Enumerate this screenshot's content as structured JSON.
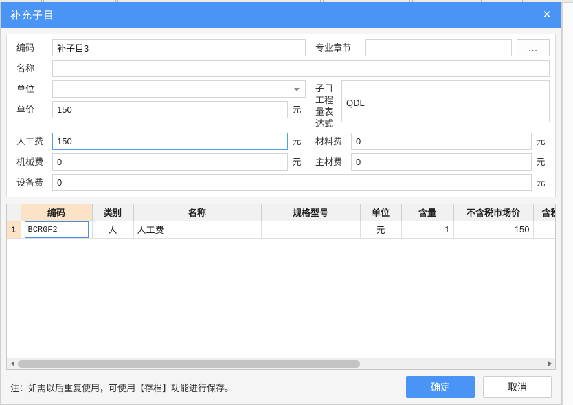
{
  "dialog": {
    "title": "补充子目",
    "close_label": "✕"
  },
  "form": {
    "code": {
      "label": "编码",
      "value": "补子目3"
    },
    "chapter": {
      "label": "专业章节",
      "value": "",
      "browse_label": "..."
    },
    "name": {
      "label": "名称",
      "value": ""
    },
    "unit": {
      "label": "单位",
      "value": ""
    },
    "quantity_expr": {
      "label": "子目工程量表达式",
      "value": "QDL"
    },
    "unit_price": {
      "label": "单价",
      "value": "150",
      "suffix": "元"
    },
    "labor_cost": {
      "label": "人工费",
      "value": "150",
      "suffix": "元"
    },
    "material_cost": {
      "label": "材料费",
      "value": "0",
      "suffix": "元"
    },
    "machine_cost": {
      "label": "机械费",
      "value": "0",
      "suffix": "元"
    },
    "main_material_cost": {
      "label": "主材费",
      "value": "0",
      "suffix": "元"
    },
    "equipment_cost": {
      "label": "设备费",
      "value": "0",
      "suffix": "元"
    }
  },
  "grid": {
    "columns": [
      {
        "key": "rownum",
        "label": ""
      },
      {
        "key": "code",
        "label": "编码"
      },
      {
        "key": "category",
        "label": "类别"
      },
      {
        "key": "name",
        "label": "名称"
      },
      {
        "key": "spec",
        "label": "规格型号"
      },
      {
        "key": "unit",
        "label": "单位"
      },
      {
        "key": "content",
        "label": "含量"
      },
      {
        "key": "price_excl_tax",
        "label": "不含税市场价"
      },
      {
        "key": "price_incl_tax",
        "label": "含税市"
      }
    ],
    "rows": [
      {
        "rownum": "1",
        "code": "BCRGF2",
        "category": "人",
        "name": "人工费",
        "spec": "",
        "unit": "元",
        "content": "1",
        "price_excl_tax": "150",
        "price_incl_tax": ""
      }
    ]
  },
  "footer": {
    "note": "注：如需以后重复使用，可使用【存档】功能进行保存。",
    "ok_label": "确定",
    "cancel_label": "取消"
  },
  "colors": {
    "title_bar": "#4a94f5",
    "primary_button": "#4a94f5",
    "header_highlight": "#fce3c8",
    "focus_border": "#5a9ded"
  }
}
